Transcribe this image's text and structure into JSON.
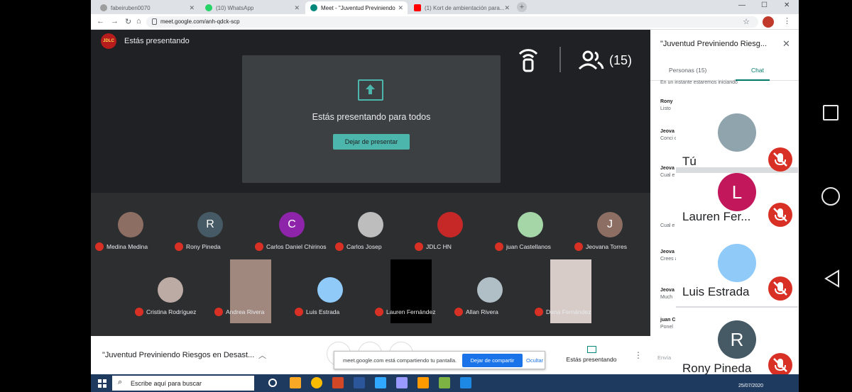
{
  "browser": {
    "tabs": [
      {
        "label": "fabeiruben0070",
        "active": false
      },
      {
        "label": "(10) WhatsApp",
        "active": false
      },
      {
        "label": "Meet - \"Juventud Previniendo",
        "active": true
      },
      {
        "label": "(1) Kort de ambientación para...",
        "active": false
      }
    ],
    "url": "meet.google.com/anh-qdck-scp"
  },
  "meet": {
    "status": "Estás presentando",
    "people_count": "(15)",
    "presentation_title": "Estás presentando para todos",
    "stop_button": "Dejar de presentar",
    "participants_row1": [
      {
        "name": "Medina Medina",
        "initial": "",
        "color": "#8d6e63"
      },
      {
        "name": "Rony Pineda",
        "initial": "R",
        "color": "#455a64"
      },
      {
        "name": "Carlos Daniel Chirinos",
        "initial": "C",
        "color": "#8e24aa"
      },
      {
        "name": "Carlos Josep",
        "initial": "",
        "color": "#bdbdbd"
      },
      {
        "name": "JDLC HN",
        "initial": "",
        "color": "#c62828"
      },
      {
        "name": "juan Castellanos",
        "initial": "",
        "color": "#a5d6a7"
      },
      {
        "name": "Jeovana Torres",
        "initial": "J",
        "color": "#8d6e63"
      }
    ],
    "participants_row2": [
      {
        "name": "Cristina Rodríguez",
        "initial": "",
        "color": "#bcaaa4"
      },
      {
        "name": "Andrea Rivera",
        "initial": "",
        "color": "#a1887f"
      },
      {
        "name": "Luis Estrada",
        "initial": "",
        "color": "#90caf9"
      },
      {
        "name": "Lauren Fernández",
        "initial": "",
        "color": "#000000"
      },
      {
        "name": "Allan Rivera",
        "initial": "",
        "color": "#b0bec5"
      },
      {
        "name": "Dana Fernández",
        "initial": "",
        "color": "#d7ccc8"
      }
    ]
  },
  "bottombar": {
    "meeting_title": "\"Juventud Previniendo Riesgos en Desast...",
    "share_notice": "meet.google.com está compartiendo tu pantalla.",
    "stop_share_button": "Dejar de compartir",
    "hide_link": "Ocultar",
    "presenting_label": "Estás presentando"
  },
  "sidepanel": {
    "title": "\"Juventud Previniendo Riesg...",
    "tab_people": "Personas (15)",
    "tab_chat": "Chat",
    "messages": [
      {
        "who": "",
        "text": "En un instante estaremos iniciando"
      },
      {
        "who": "Rony",
        "text": "Listo"
      },
      {
        "who": "Jeova",
        "text": "Conci carrile"
      },
      {
        "who": "Jeova",
        "text": "Cual e insign ambu cotidi"
      },
      {
        "who": "",
        "text": "Cual e"
      },
      {
        "who": "Jeova",
        "text": "Crees años s"
      },
      {
        "who": "Jeova",
        "text": "Much"
      },
      {
        "who": "juan C",
        "text": "Ponel"
      }
    ],
    "input_placeholder": "Envía"
  },
  "floating_panel": {
    "cards": [
      {
        "name": "Tú",
        "initial": "",
        "color": "#90a4ae"
      },
      {
        "name": "Lauren Fer...",
        "initial": "L",
        "color": "#c2185b"
      },
      {
        "name": "Luis Estrada",
        "initial": "",
        "color": "#90caf9"
      },
      {
        "name": "Rony Pineda",
        "initial": "R",
        "color": "#455a64"
      }
    ]
  },
  "taskbar": {
    "search_placeholder": "Escribe aquí para buscar",
    "date": "25/07/2020"
  },
  "colors": {
    "meet_dark": "#202124",
    "teal": "#4db6ac",
    "mic_red": "#d93025",
    "link_blue": "#1a73e8"
  }
}
